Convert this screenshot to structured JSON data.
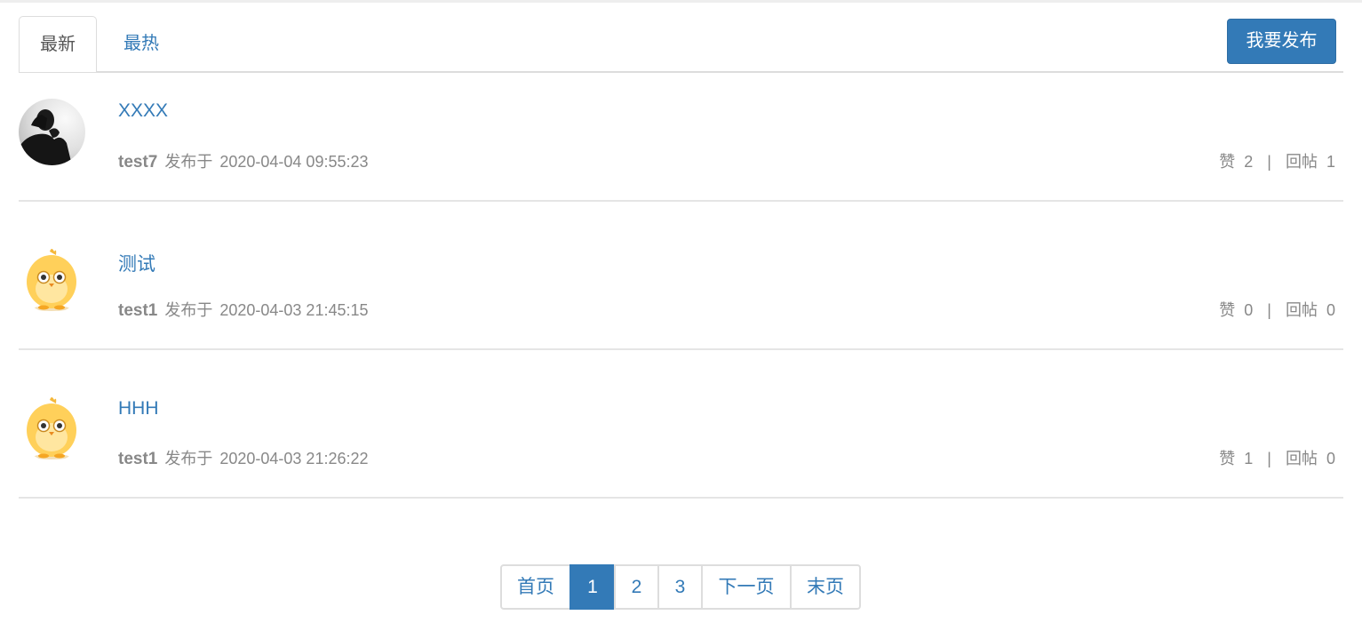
{
  "tabs": [
    {
      "label": "最新",
      "active": true
    },
    {
      "label": "最热",
      "active": false
    }
  ],
  "publish_button": "我要发布",
  "posts": [
    {
      "title": "XXXX",
      "author": "test7",
      "published_label": "发布于",
      "time": "2020-04-04 09:55:23",
      "like_label": "赞",
      "likes": "2",
      "separator": "|",
      "reply_label": "回帖",
      "replies": "1",
      "avatar": "silhouette-avatar"
    },
    {
      "title": "测试",
      "author": "test1",
      "published_label": "发布于",
      "time": "2020-04-03 21:45:15",
      "like_label": "赞",
      "likes": "0",
      "separator": "|",
      "reply_label": "回帖",
      "replies": "0",
      "avatar": "chick-avatar"
    },
    {
      "title": "HHH",
      "author": "test1",
      "published_label": "发布于",
      "time": "2020-04-03 21:26:22",
      "like_label": "赞",
      "likes": "1",
      "separator": "|",
      "reply_label": "回帖",
      "replies": "0",
      "avatar": "chick-avatar"
    }
  ],
  "pagination": {
    "first": "首页",
    "pages": [
      "1",
      "2",
      "3"
    ],
    "current": "1",
    "next": "下一页",
    "last": "末页"
  },
  "colors": {
    "accent": "#337ab7",
    "muted": "#888888",
    "border": "#dddddd"
  }
}
